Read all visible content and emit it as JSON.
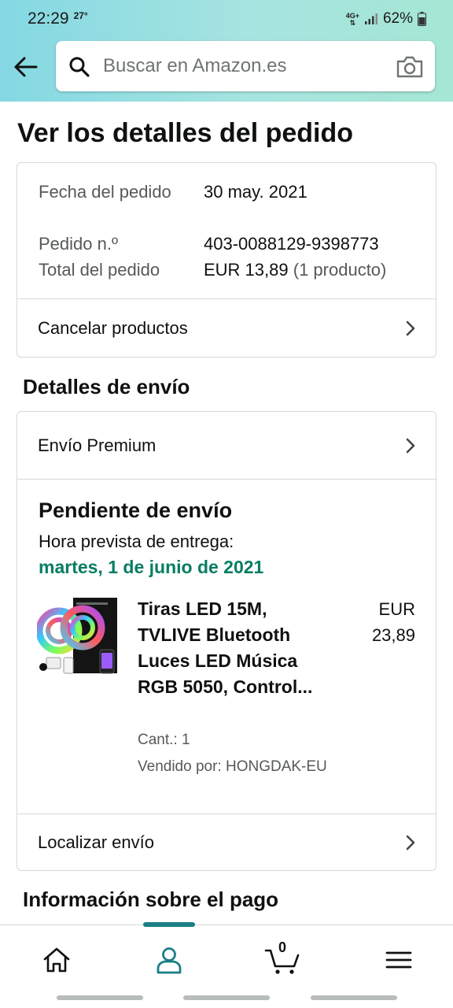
{
  "status_bar": {
    "time": "22:29",
    "temperature": "27°",
    "network": "4G+",
    "battery": "62%"
  },
  "search": {
    "placeholder": "Buscar en Amazon.es"
  },
  "page": {
    "title": "Ver los detalles del pedido"
  },
  "order_summary": {
    "date_label": "Fecha del pedido",
    "date_value": "30 may. 2021",
    "number_label": "Pedido n.º",
    "number_value": "403-0088129-9398773",
    "total_label": "Total del pedido",
    "total_value": "EUR 13,89",
    "total_items": "(1 producto)",
    "cancel_label": "Cancelar productos"
  },
  "shipping": {
    "section_title": "Detalles de envío",
    "shipping_speed": "Envío Premium",
    "status": "Pendiente de envío",
    "eta_label": "Hora prevista de entrega:",
    "eta_date": "martes, 1 de junio de 2021",
    "track_label": "Localizar envío",
    "product": {
      "name": "Tiras LED 15M, TVLIVE Bluetooth Luces LED Música RGB 5050, Control...",
      "price": "EUR 23,89",
      "quantity": "Cant.: 1",
      "seller": "Vendido por: HONGDAK-EU"
    }
  },
  "payment": {
    "section_title": "Información sobre el pago"
  },
  "bottom_nav": {
    "cart_count": "0",
    "active_tab": "account",
    "accent_color": "#1a7f87"
  },
  "colors": {
    "eta_green": "#067d62",
    "header_gradient_start": "#84d8e3",
    "header_gradient_end": "#a5e6d4"
  }
}
